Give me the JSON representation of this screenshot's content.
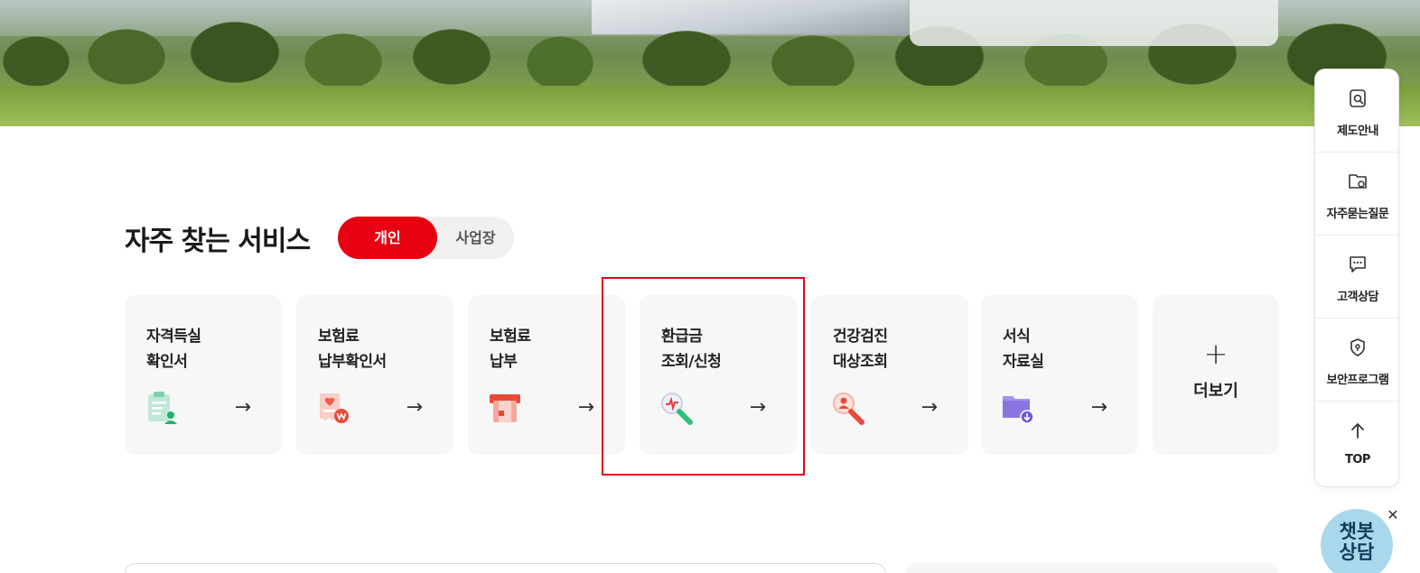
{
  "section": {
    "title": "자주 찾는 서비스",
    "toggle": {
      "active": "개인",
      "inactive": "사업장"
    }
  },
  "cards": [
    {
      "line1": "자격득실",
      "line2": "확인서",
      "icon": "clipboard-person-icon",
      "arrow": "→"
    },
    {
      "line1": "보험료",
      "line2": "납부확인서",
      "icon": "receipt-heart-icon",
      "arrow": "→"
    },
    {
      "line1": "보험료",
      "line2": "납부",
      "icon": "card-payment-icon",
      "arrow": "→"
    },
    {
      "line1": "환급금",
      "line2": "조회/신청",
      "icon": "search-pulse-icon",
      "arrow": "→"
    },
    {
      "line1": "건강검진",
      "line2": "대상조회",
      "icon": "search-person-icon",
      "arrow": "→"
    },
    {
      "line1": "서식",
      "line2": "자료실",
      "icon": "folder-download-icon",
      "arrow": "→"
    }
  ],
  "more": {
    "plus": "+",
    "label": "더보기"
  },
  "quick_menu": [
    {
      "label": "제도안내",
      "icon": "document-icon"
    },
    {
      "label": "자주묻는질문",
      "icon": "folder-question-icon"
    },
    {
      "label": "고객상담",
      "icon": "chat-icon"
    },
    {
      "label": "보안프로그램",
      "icon": "shield-icon"
    },
    {
      "label": "TOP",
      "icon": "arrow-up-icon"
    }
  ],
  "chatbot": {
    "line1": "챗봇",
    "line2": "상담",
    "close": "✕"
  },
  "colors": {
    "accent": "#e60012",
    "card_bg": "#f7f7f7"
  }
}
